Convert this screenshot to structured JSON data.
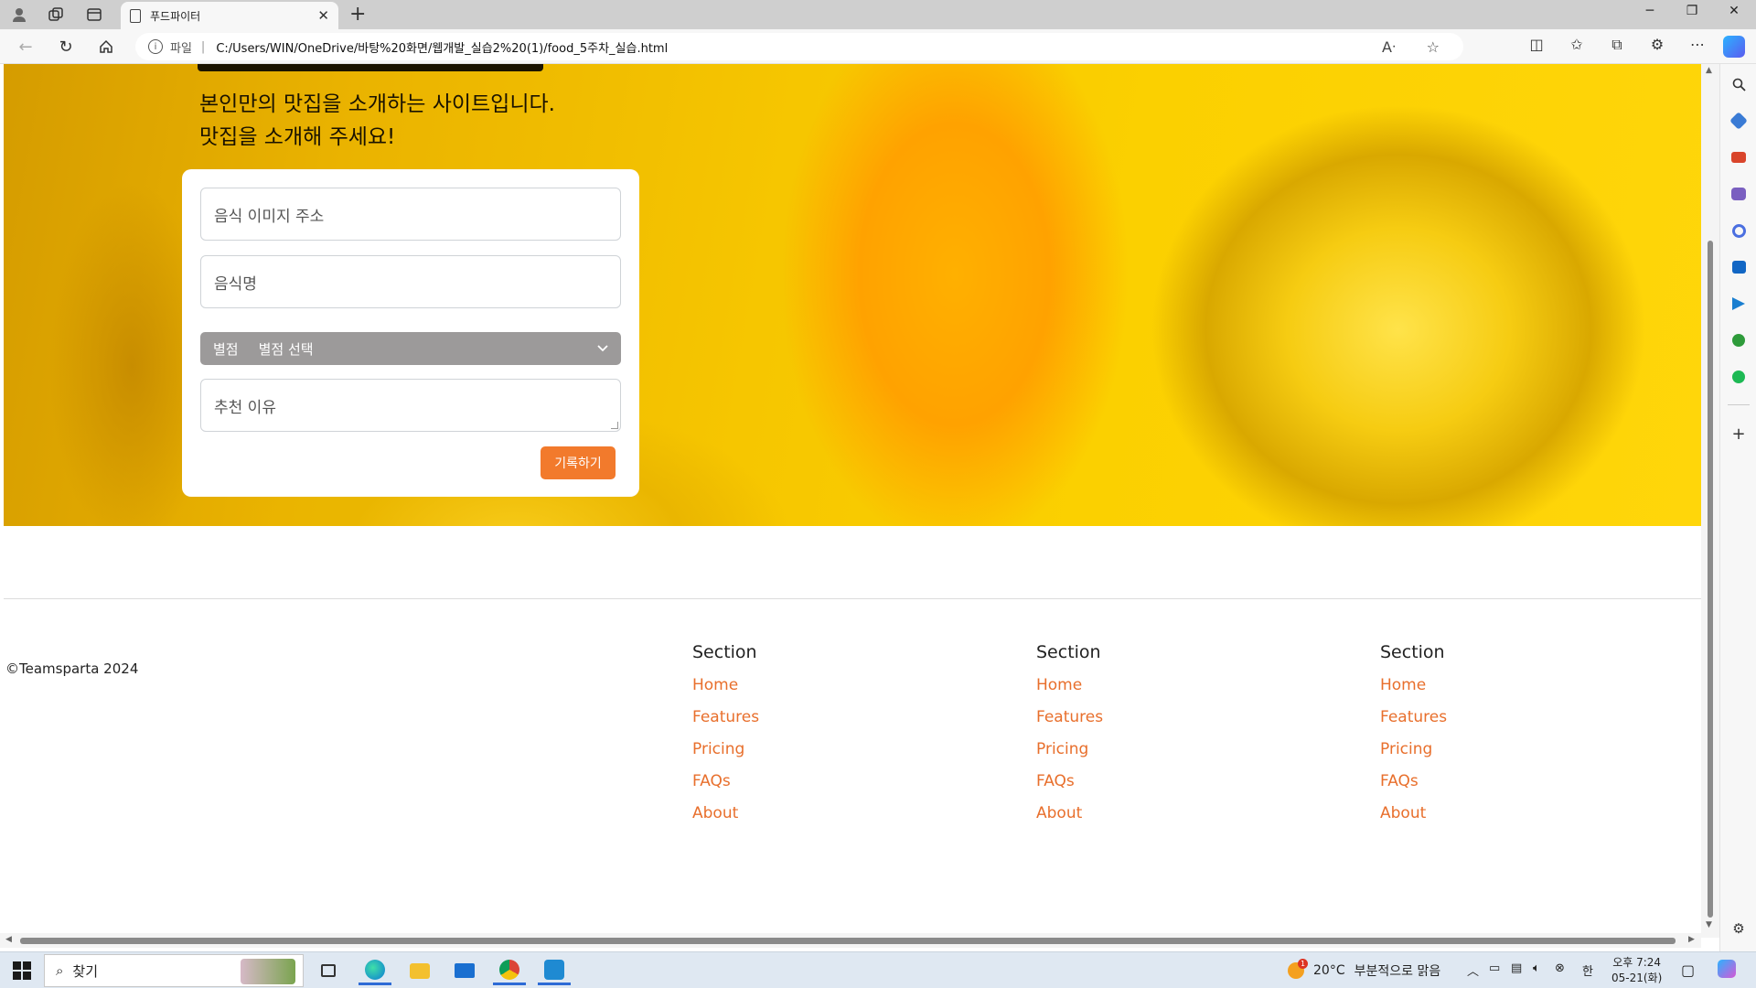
{
  "browser": {
    "tab_title": "푸드파이터",
    "url_label": "파일",
    "url": "C:/Users/WIN/OneDrive/바탕%20화면/웹개발_실습2%20(1)/food_5주차_실습.html"
  },
  "hero": {
    "subtitle_line1": "본인만의 맛집을 소개하는 사이트입니다.",
    "subtitle_line2": "맛집을 소개해 주세요!"
  },
  "form": {
    "image_url_placeholder": "음식 이미지 주소",
    "food_name_placeholder": "음식명",
    "rating_label": "별점",
    "rating_value": "별점 선택",
    "reason_placeholder": "추천 이유",
    "submit_label": "기록하기"
  },
  "footer": {
    "copyright": "©Teamsparta 2024",
    "columns": [
      {
        "title": "Section",
        "links": [
          "Home",
          "Features",
          "Pricing",
          "FAQs",
          "About"
        ]
      },
      {
        "title": "Section",
        "links": [
          "Home",
          "Features",
          "Pricing",
          "FAQs",
          "About"
        ]
      },
      {
        "title": "Section",
        "links": [
          "Home",
          "Features",
          "Pricing",
          "FAQs",
          "About"
        ]
      }
    ]
  },
  "taskbar": {
    "search_label": "찾기",
    "weather_temp": "20°C",
    "weather_desc": "부분적으로 맑음",
    "weather_badge": "1",
    "ime": "한",
    "time": "오후 7:24",
    "date": "05-21(화)"
  },
  "colors": {
    "accent": "#f27a2c",
    "link": "#e86f2c",
    "select_bg": "#9c9a9a"
  }
}
